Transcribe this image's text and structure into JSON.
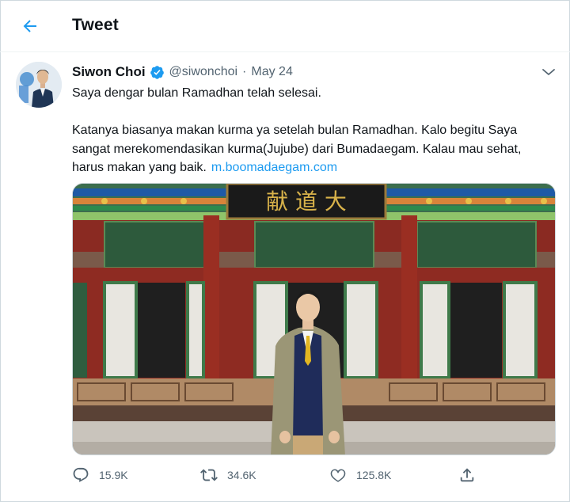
{
  "header": {
    "back_icon": "arrow-left-icon",
    "title": "Tweet"
  },
  "tweet": {
    "author": {
      "display_name": "Siwon Choi",
      "verified": true,
      "handle": "@siwonchoi"
    },
    "separator": "·",
    "date": "May 24",
    "text": {
      "paragraph1": "Saya dengar bulan Ramadhan telah selesai.",
      "paragraph2": "Katanya biasanya makan kurma ya setelah bulan Ramadhan. Kalo begitu Saya sangat merekomendasikan kurma(Jujube) dari Bumadaegam. Kalau mau sehat, harus makan yang baik.",
      "link": "m.boomadaegam.com"
    },
    "actions": {
      "reply_count": "15.9K",
      "retweet_count": "34.6K",
      "like_count": "125.8K"
    }
  },
  "colors": {
    "accent": "#1d9bf0",
    "text": "#0f1419",
    "muted": "#536471"
  }
}
